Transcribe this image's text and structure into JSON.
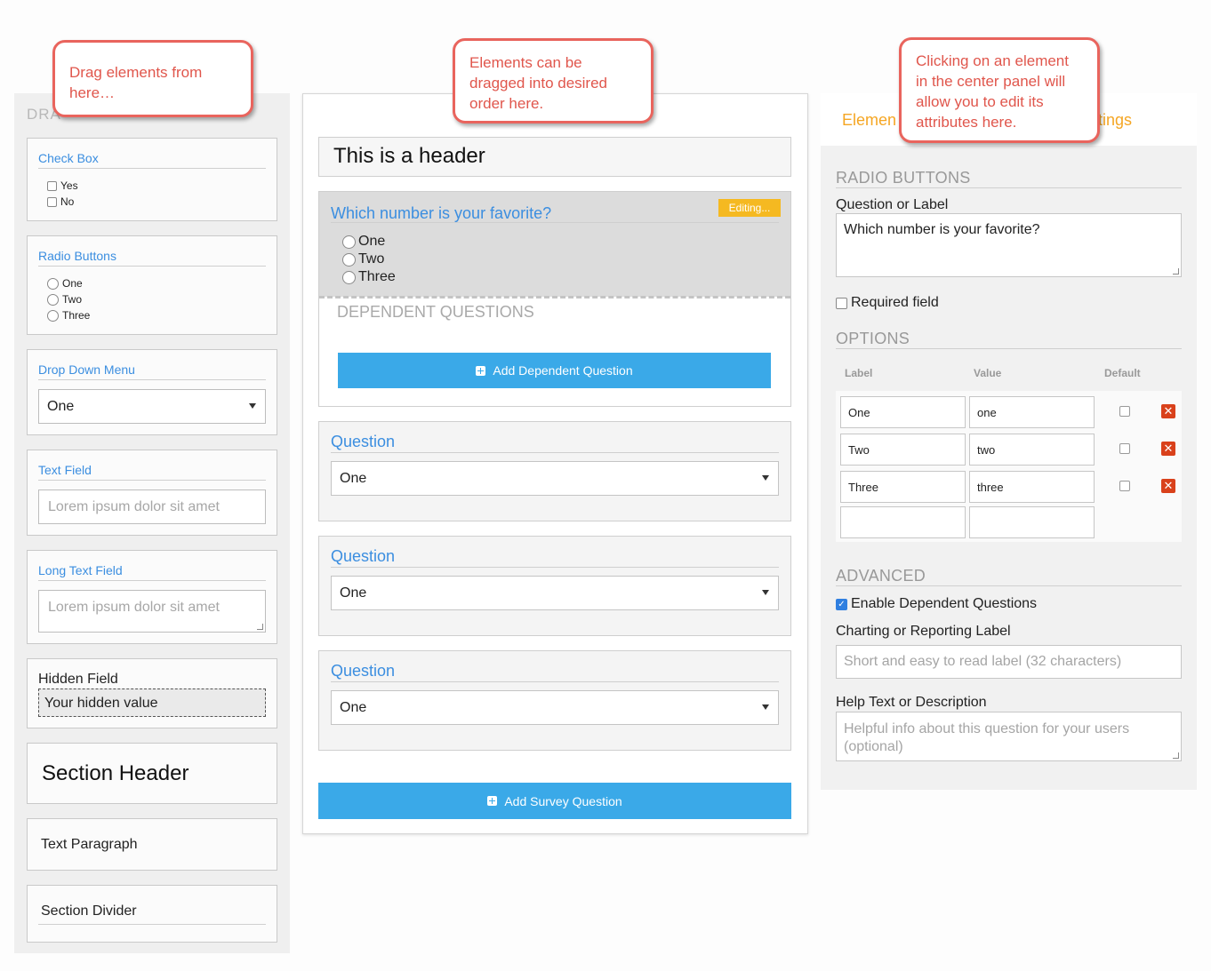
{
  "left_panel": {
    "title": "DRA",
    "checkbox_card": {
      "title": "Check Box",
      "options": [
        "Yes",
        "No"
      ]
    },
    "radio_card": {
      "title": "Radio Buttons",
      "options": [
        "One",
        "Two",
        "Three"
      ]
    },
    "dropdown_card": {
      "title": "Drop Down Menu",
      "value": "One"
    },
    "textfield_card": {
      "title": "Text Field",
      "placeholder": "Lorem ipsum dolor sit amet"
    },
    "longtext_card": {
      "title": "Long Text Field",
      "placeholder": "Lorem ipsum dolor sit amet"
    },
    "hidden_card": {
      "title": "Hidden Field",
      "value": "Your hidden value"
    },
    "section_header_card": {
      "label": "Section Header"
    },
    "text_paragraph_card": {
      "label": "Text Paragraph"
    },
    "section_divider_card": {
      "label": "Section Divider"
    }
  },
  "center_panel": {
    "header_text": "This is a header",
    "editing_question": {
      "title": "Which number is your favorite?",
      "badge": "Editing...",
      "options": [
        "One",
        "Two",
        "Three"
      ],
      "dependent_label": "DEPENDENT QUESTIONS",
      "add_dependent_button": "Add Dependent Question"
    },
    "questions": [
      {
        "title": "Question",
        "value": "One"
      },
      {
        "title": "Question",
        "value": "One"
      },
      {
        "title": "Question",
        "value": "One"
      }
    ],
    "add_survey_button": "Add Survey Question"
  },
  "right_panel": {
    "tab_left": "Elemen",
    "tab_right": "tings",
    "section_title": "RADIO BUTTONS",
    "question_label": "Question or Label",
    "question_value": "Which number is your favorite?",
    "required_label": "Required field",
    "options_title": "OPTIONS",
    "options_headers": {
      "label": "Label",
      "value": "Value",
      "default": "Default"
    },
    "options": [
      {
        "label": "One",
        "value": "one"
      },
      {
        "label": "Two",
        "value": "two"
      },
      {
        "label": "Three",
        "value": "three"
      },
      {
        "label": "",
        "value": ""
      }
    ],
    "advanced_title": "ADVANCED",
    "enable_dependent_label": "Enable Dependent Questions",
    "charting_label": "Charting or Reporting Label",
    "charting_placeholder": "Short and easy to read label (32 characters)",
    "help_label": "Help Text or Description",
    "help_placeholder": "Helpful info about this question for your users (optional)"
  },
  "callouts": {
    "left": "Drag elements from here…",
    "center": "Elements can be dragged into desired order here.",
    "right": "Clicking on an element in the center panel will allow you to edit its attributes here."
  },
  "colors": {
    "accent_blue": "#3aa9e8",
    "link_blue": "#3b8ee0",
    "callout_red": "#e9645d",
    "editing_badge": "#f5b921",
    "delete_red": "#d9411b",
    "tab_orange": "#f5a623"
  },
  "icons": {
    "plus": "plus-square-icon",
    "delete": "close-x-icon",
    "caret": "caret-down-icon"
  }
}
